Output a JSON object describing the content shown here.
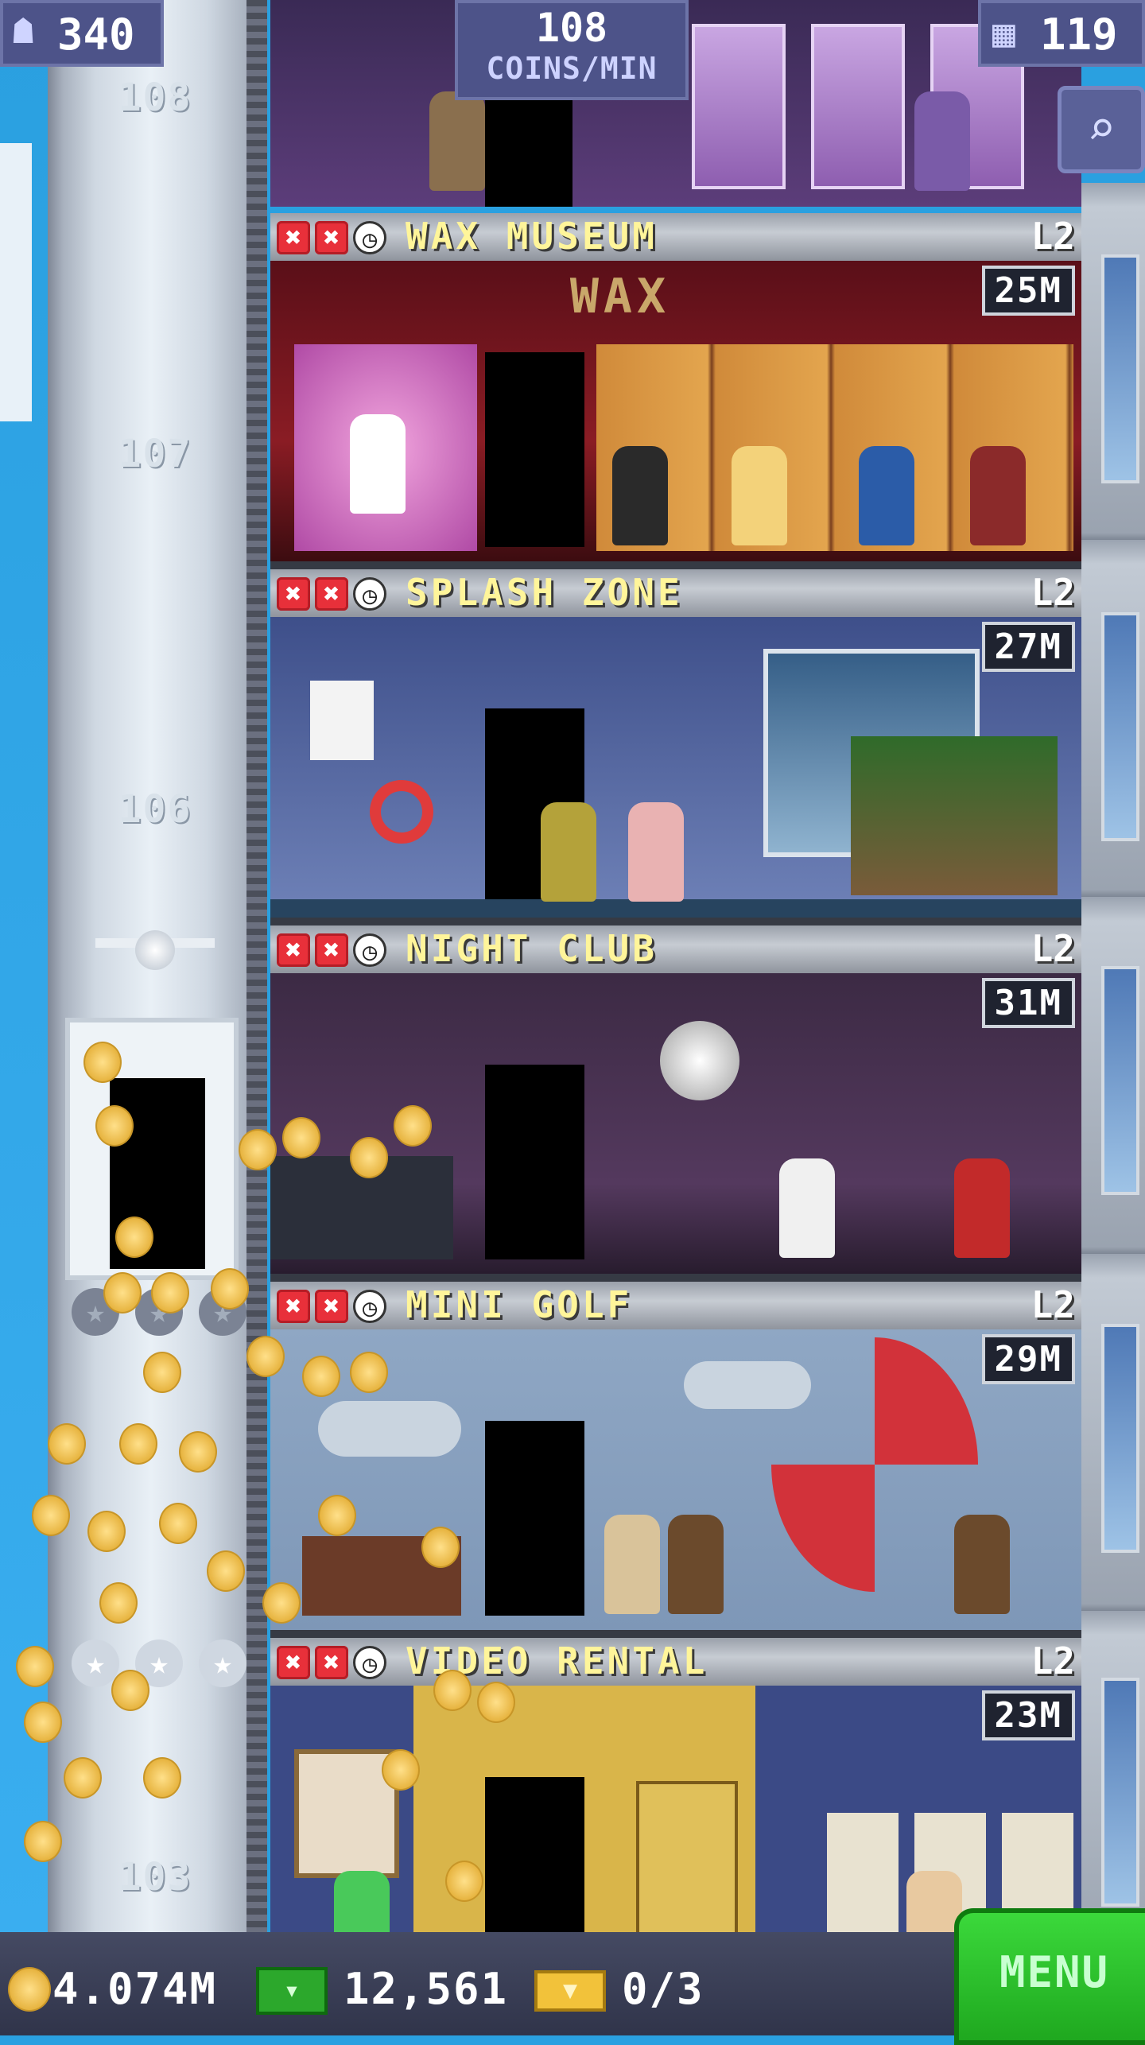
{
  "top_bar": {
    "population": "340",
    "population_icon": "person-icon",
    "coins_rate_value": "108",
    "coins_rate_unit": "COINS/MIN",
    "floors_count": "119",
    "floors_icon": "building-icon"
  },
  "elevator": {
    "floor_labels": [
      "108",
      "107",
      "106",
      "103"
    ]
  },
  "floors": [
    {
      "name": "WAX MUSEUM",
      "level": "L2",
      "value": "25M",
      "sign": "WAX"
    },
    {
      "name": "SPLASH ZONE",
      "level": "L2",
      "value": "27M"
    },
    {
      "name": "NIGHT CLUB",
      "level": "L2",
      "value": "31M"
    },
    {
      "name": "MINI GOLF",
      "level": "L2",
      "value": "29M"
    },
    {
      "name": "VIDEO RENTAL",
      "level": "L2",
      "value": "23M"
    }
  ],
  "status_icons": [
    "x-icon",
    "x-icon",
    "clock-icon"
  ],
  "bottom_bar": {
    "coins": "4.074M",
    "coins_icon": "coin-icon",
    "bux": "12,561",
    "bux_icon": "bux-icon",
    "tickets": "0/3",
    "tickets_icon": "ticket-icon",
    "menu_label": "MENU"
  },
  "colors": {
    "floor_name": "#fff59a",
    "menu_green": "#2ac52a",
    "top_bar_bg": "#4d5389"
  }
}
